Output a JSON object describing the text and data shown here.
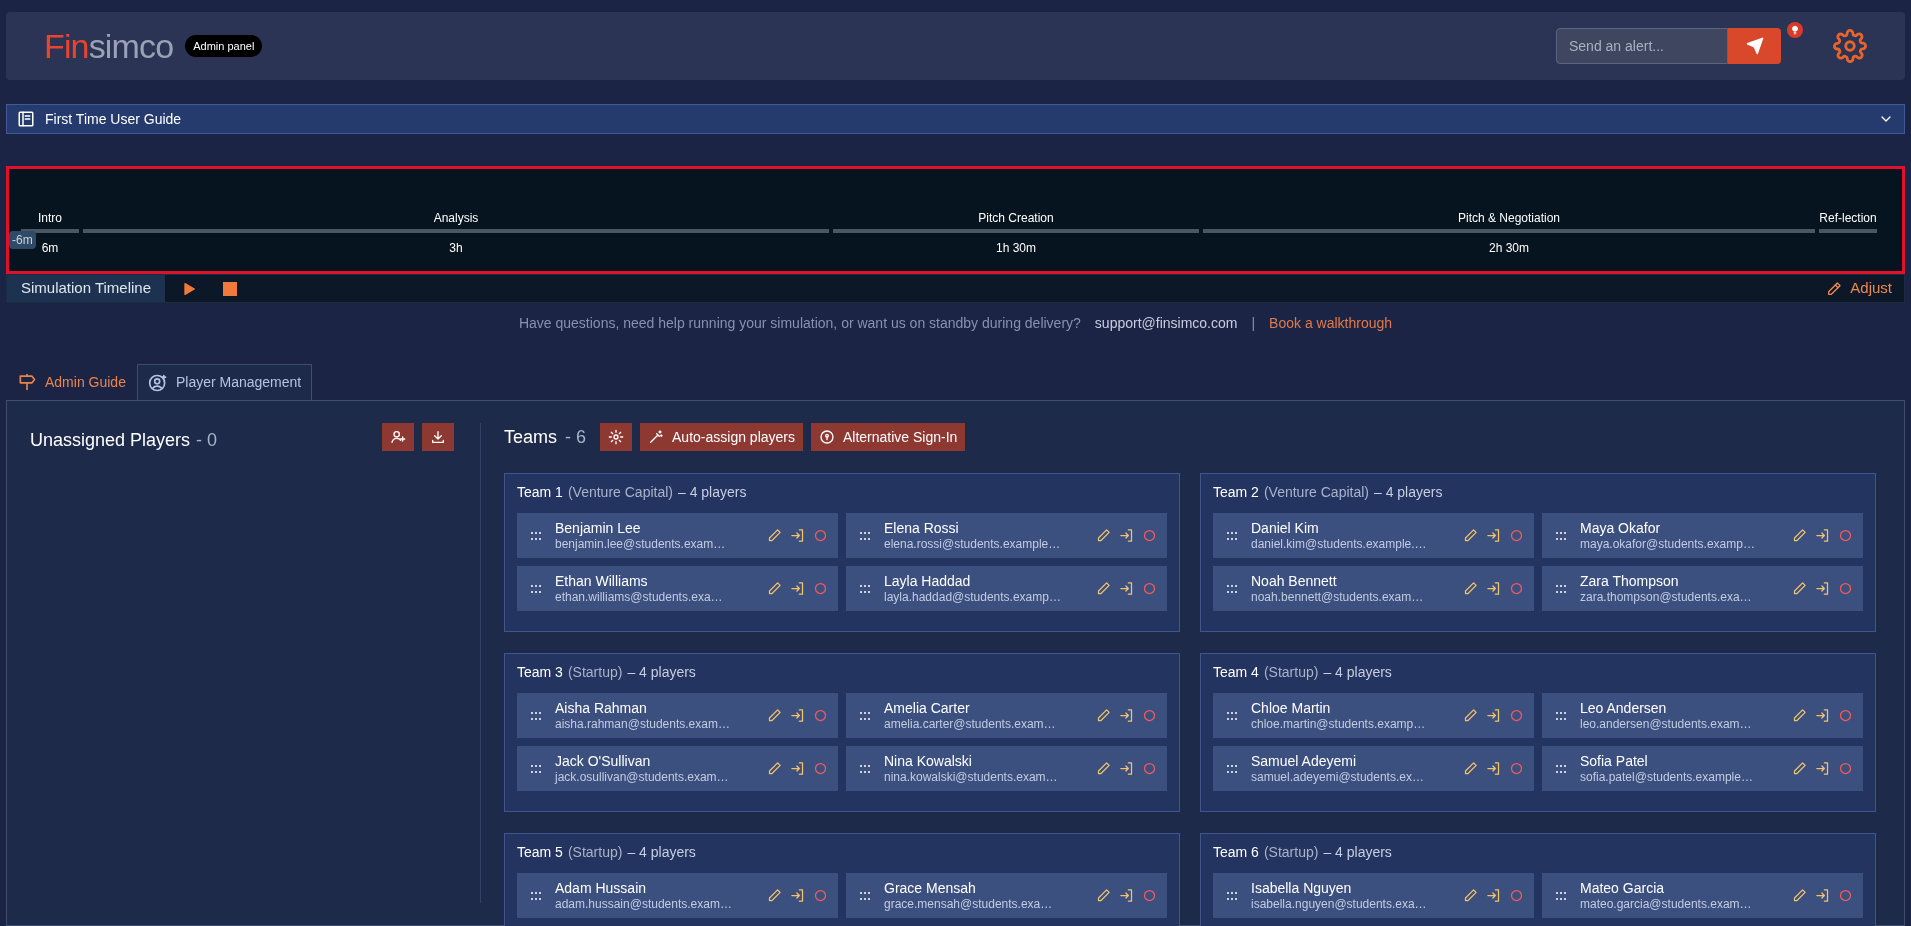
{
  "header": {
    "logo": {
      "accent": "Fin",
      "rest": "simco"
    },
    "badge": "Admin panel",
    "alert_field": {
      "placeholder": "Send an alert..."
    }
  },
  "guide": {
    "title": "First Time User Guide",
    "expanded": false
  },
  "timeline": {
    "marker": "-6m",
    "phases": [
      {
        "label": "Intro",
        "duration": "6m"
      },
      {
        "label": "Analysis",
        "duration": "3h"
      },
      {
        "label": "Pitch Creation",
        "duration": "1h 30m"
      },
      {
        "label": "Pitch & Negotiation",
        "duration": "2h 30m"
      },
      {
        "label": "Ref-lection"
      }
    ]
  },
  "sim_bar": {
    "label": "Simulation Timeline",
    "adjust": "Adjust"
  },
  "help": {
    "text": "Have questions, need help running your simulation, or want us on standby during delivery?",
    "email": "support@finsimco.com",
    "separator": "|",
    "link": "Book a walkthrough"
  },
  "tabs": [
    {
      "label": "Admin Guide",
      "selected": false
    },
    {
      "label": "Player Management",
      "selected": true
    }
  ],
  "unassigned": {
    "title": "Unassigned Players",
    "count": "- 0"
  },
  "teams_header": {
    "title": "Teams",
    "count": "- 6",
    "buttons": [
      "Auto-assign players",
      "Alternative Sign-In"
    ]
  },
  "teams": [
    {
      "name": "Team 1",
      "type": "(Venture Capital)",
      "count": "– 4 players",
      "players": [
        {
          "name": "Benjamin Lee",
          "email": "benjamin.lee@students.exam…"
        },
        {
          "name": "Elena Rossi",
          "email": "elena.rossi@students.example…"
        },
        {
          "name": "Ethan Williams",
          "email": "ethan.williams@students.exa…"
        },
        {
          "name": "Layla Haddad",
          "email": "layla.haddad@students.examp…"
        }
      ]
    },
    {
      "name": "Team 2",
      "type": "(Venture Capital)",
      "count": "– 4 players",
      "players": [
        {
          "name": "Daniel Kim",
          "email": "daniel.kim@students.example.…"
        },
        {
          "name": "Maya Okafor",
          "email": "maya.okafor@students.examp…"
        },
        {
          "name": "Noah Bennett",
          "email": "noah.bennett@students.exam…"
        },
        {
          "name": "Zara Thompson",
          "email": "zara.thompson@students.exa…"
        }
      ]
    },
    {
      "name": "Team 3",
      "type": "(Startup)",
      "count": "– 4 players",
      "players": [
        {
          "name": "Aisha Rahman",
          "email": "aisha.rahman@students.exam…"
        },
        {
          "name": "Amelia Carter",
          "email": "amelia.carter@students.exam…"
        },
        {
          "name": "Jack O'Sullivan",
          "email": "jack.osullivan@students.exam…"
        },
        {
          "name": "Nina Kowalski",
          "email": "nina.kowalski@students.exam…"
        }
      ]
    },
    {
      "name": "Team 4",
      "type": "(Startup)",
      "count": "– 4 players",
      "players": [
        {
          "name": "Chloe Martin",
          "email": "chloe.martin@students.examp…"
        },
        {
          "name": "Leo Andersen",
          "email": "leo.andersen@students.exam…"
        },
        {
          "name": "Samuel Adeyemi",
          "email": "samuel.adeyemi@students.ex…"
        },
        {
          "name": "Sofia Patel",
          "email": "sofia.patel@students.example…"
        }
      ]
    },
    {
      "name": "Team 5",
      "type": "(Startup)",
      "count": "– 4 players",
      "players": [
        {
          "name": "Adam Hussain",
          "email": "adam.hussain@students.exam…"
        },
        {
          "name": "Grace Mensah",
          "email": "grace.mensah@students.exa…"
        }
      ]
    },
    {
      "name": "Team 6",
      "type": "(Startup)",
      "count": "– 4 players",
      "players": [
        {
          "name": "Isabella Nguyen",
          "email": "isabella.nguyen@students.exa…"
        },
        {
          "name": "Mateo Garcia",
          "email": "mateo.garcia@students.exam…"
        }
      ]
    }
  ]
}
